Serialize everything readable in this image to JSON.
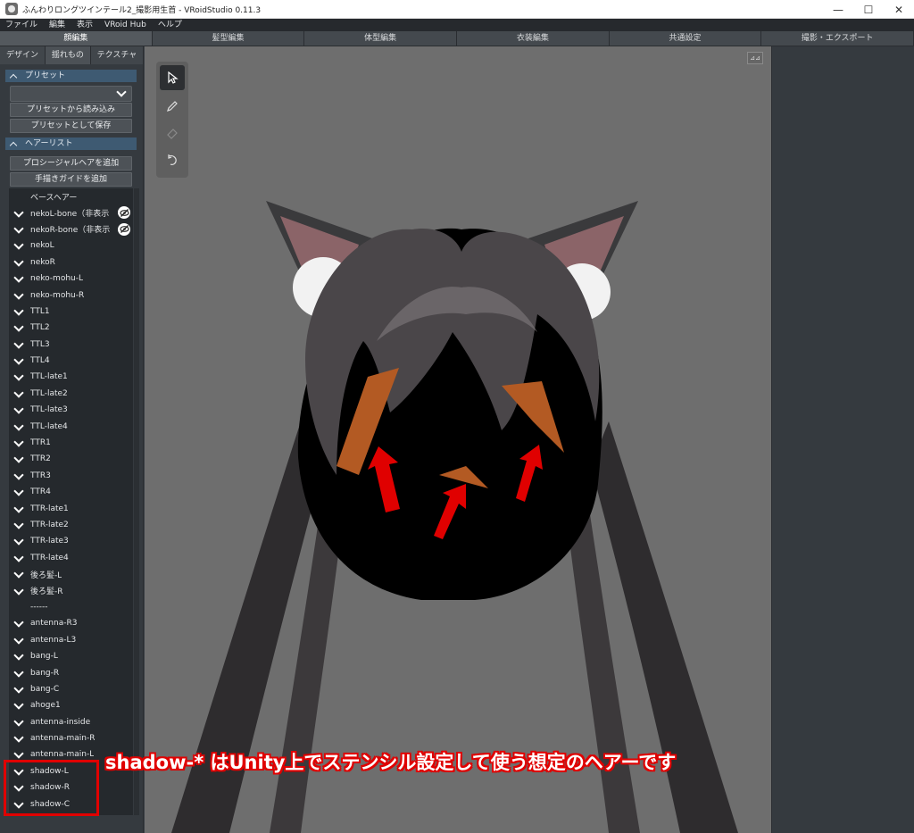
{
  "window": {
    "title": "ふんわりロングツインテール2_撮影用生首 - VRoidStudio 0.11.3",
    "minimize": "—",
    "maximize": "☐",
    "close": "✕"
  },
  "menubar": [
    "ファイル",
    "編集",
    "表示",
    "VRoid Hub",
    "ヘルプ"
  ],
  "main_tabs": [
    {
      "label": "顔編集",
      "active": true
    },
    {
      "label": "髪型編集",
      "active": false
    },
    {
      "label": "体型編集",
      "active": false
    },
    {
      "label": "衣装編集",
      "active": false
    },
    {
      "label": "共通設定",
      "active": false
    },
    {
      "label": "撮影・エクスポート",
      "active": false
    }
  ],
  "sub_tabs": [
    "デザイン",
    "揺れもの",
    "テクスチャ"
  ],
  "preset_section": {
    "title": "プリセット",
    "load_button": "プリセットから読み込み",
    "save_button": "プリセットとして保存"
  },
  "hairlist_section": {
    "title": "ヘアーリスト",
    "add_procedural": "プロシージャルヘアを追加",
    "add_handdrawn": "手描きガイドを追加",
    "items": [
      {
        "label": "ベースヘアー",
        "chevron": false,
        "hidden": false
      },
      {
        "label": "nekoL-bone（非表示",
        "chevron": true,
        "hidden": true
      },
      {
        "label": "nekoR-bone（非表示",
        "chevron": true,
        "hidden": true
      },
      {
        "label": "nekoL",
        "chevron": true,
        "hidden": false
      },
      {
        "label": "nekoR",
        "chevron": true,
        "hidden": false
      },
      {
        "label": "neko-mohu-L",
        "chevron": true,
        "hidden": false
      },
      {
        "label": "neko-mohu-R",
        "chevron": true,
        "hidden": false
      },
      {
        "label": "TTL1",
        "chevron": true,
        "hidden": false
      },
      {
        "label": "TTL2",
        "chevron": true,
        "hidden": false
      },
      {
        "label": "TTL3",
        "chevron": true,
        "hidden": false
      },
      {
        "label": "TTL4",
        "chevron": true,
        "hidden": false
      },
      {
        "label": "TTL-late1",
        "chevron": true,
        "hidden": false
      },
      {
        "label": "TTL-late2",
        "chevron": true,
        "hidden": false
      },
      {
        "label": "TTL-late3",
        "chevron": true,
        "hidden": false
      },
      {
        "label": "TTL-late4",
        "chevron": true,
        "hidden": false
      },
      {
        "label": "TTR1",
        "chevron": true,
        "hidden": false
      },
      {
        "label": "TTR2",
        "chevron": true,
        "hidden": false
      },
      {
        "label": "TTR3",
        "chevron": true,
        "hidden": false
      },
      {
        "label": "TTR4",
        "chevron": true,
        "hidden": false
      },
      {
        "label": "TTR-late1",
        "chevron": true,
        "hidden": false
      },
      {
        "label": "TTR-late2",
        "chevron": true,
        "hidden": false
      },
      {
        "label": "TTR-late3",
        "chevron": true,
        "hidden": false
      },
      {
        "label": "TTR-late4",
        "chevron": true,
        "hidden": false
      },
      {
        "label": "後ろ髪-L",
        "chevron": true,
        "hidden": false
      },
      {
        "label": "後ろ髪-R",
        "chevron": true,
        "hidden": false
      },
      {
        "label": "------",
        "chevron": false,
        "hidden": false
      },
      {
        "label": "antenna-R3",
        "chevron": true,
        "hidden": false
      },
      {
        "label": "antenna-L3",
        "chevron": true,
        "hidden": false
      },
      {
        "label": "bang-L",
        "chevron": true,
        "hidden": false
      },
      {
        "label": "bang-R",
        "chevron": true,
        "hidden": false
      },
      {
        "label": "bang-C",
        "chevron": true,
        "hidden": false
      },
      {
        "label": "ahoge1",
        "chevron": true,
        "hidden": false
      },
      {
        "label": "antenna-inside",
        "chevron": true,
        "hidden": false
      },
      {
        "label": "antenna-main-R",
        "chevron": true,
        "hidden": false
      },
      {
        "label": "antenna-main-L",
        "chevron": true,
        "hidden": false
      },
      {
        "label": "shadow-L",
        "chevron": true,
        "hidden": false
      },
      {
        "label": "shadow-R",
        "chevron": true,
        "hidden": false
      },
      {
        "label": "shadow-C",
        "chevron": true,
        "hidden": false
      }
    ]
  },
  "viewport": {
    "tools": [
      "select-tool-icon",
      "pen-tool-icon",
      "eraser-tool-icon",
      "rotate-tool-icon"
    ],
    "corner_button": "⊿⊿"
  },
  "annotation": "shadow-* はUnity上でステンシル設定して使う想定のヘアーです",
  "colors": {
    "accent_red": "#e00000",
    "section_header": "#3e5a72",
    "viewport_bg": "#6e6e6e"
  }
}
